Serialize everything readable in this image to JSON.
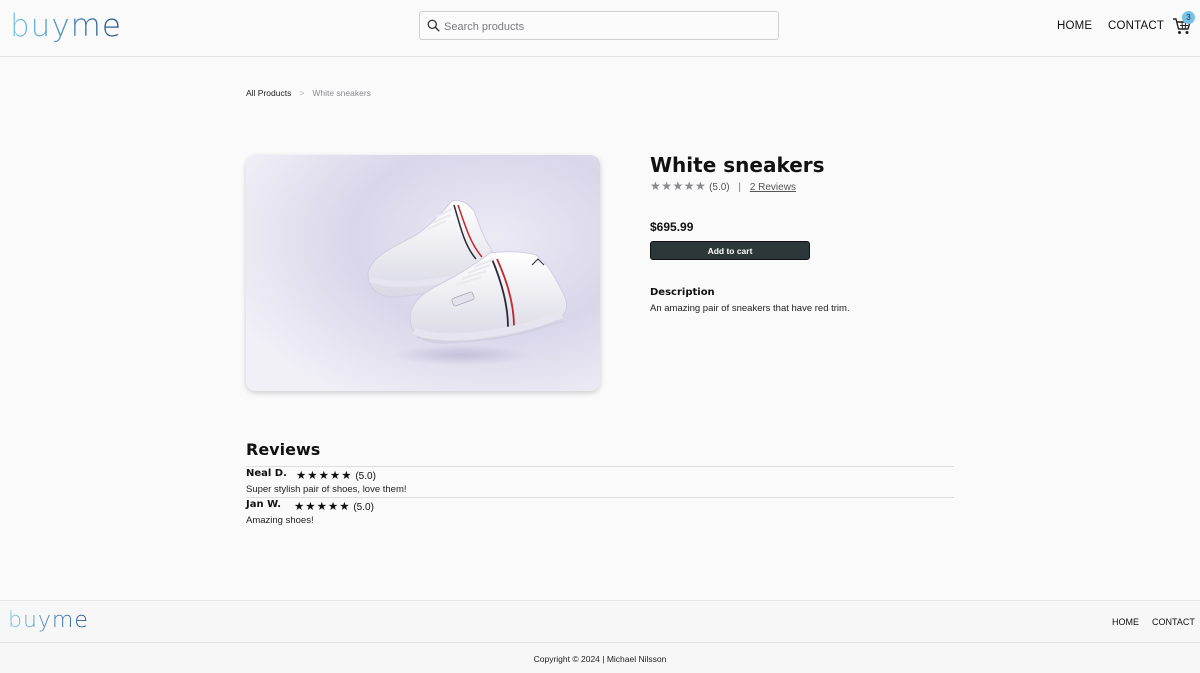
{
  "header": {
    "logo": "buyme",
    "search_placeholder": "Search products",
    "nav": {
      "home": "HOME",
      "contact": "CONTACT"
    },
    "cart_count": "3",
    "icons": {
      "search": "search-icon",
      "cart": "cart-icon"
    }
  },
  "breadcrumb": {
    "root": "All Products",
    "separator": ">",
    "current": "White sneakers"
  },
  "product": {
    "title": "White sneakers",
    "stars": "★★★★★",
    "rating": "(5.0)",
    "divider": "|",
    "reviews_link": "2 Reviews",
    "price": "$695.99",
    "add_to_cart": "Add to cart",
    "description_heading": "Description",
    "description": "An amazing pair of sneakers that have red trim."
  },
  "reviews": {
    "heading": "Reviews",
    "items": [
      {
        "name": "Neal D.",
        "stars": "★★★★★",
        "rating": "(5.0)",
        "text": "Super stylish pair of shoes, love them!"
      },
      {
        "name": "Jan W.",
        "stars": "★★★★★",
        "rating": "(5.0)",
        "text": "Amazing shoes!"
      }
    ]
  },
  "footer": {
    "logo": "buyme",
    "nav": {
      "home": "HOME",
      "contact": "CONTACT"
    },
    "copyright": "Copyright © 2024 | Michael Nilsson"
  },
  "colors": {
    "logo_light": "#7ecbe6",
    "logo_dark": "#1f4f86",
    "button_bg": "#2c3739",
    "badge_bg": "#79c1e6"
  }
}
